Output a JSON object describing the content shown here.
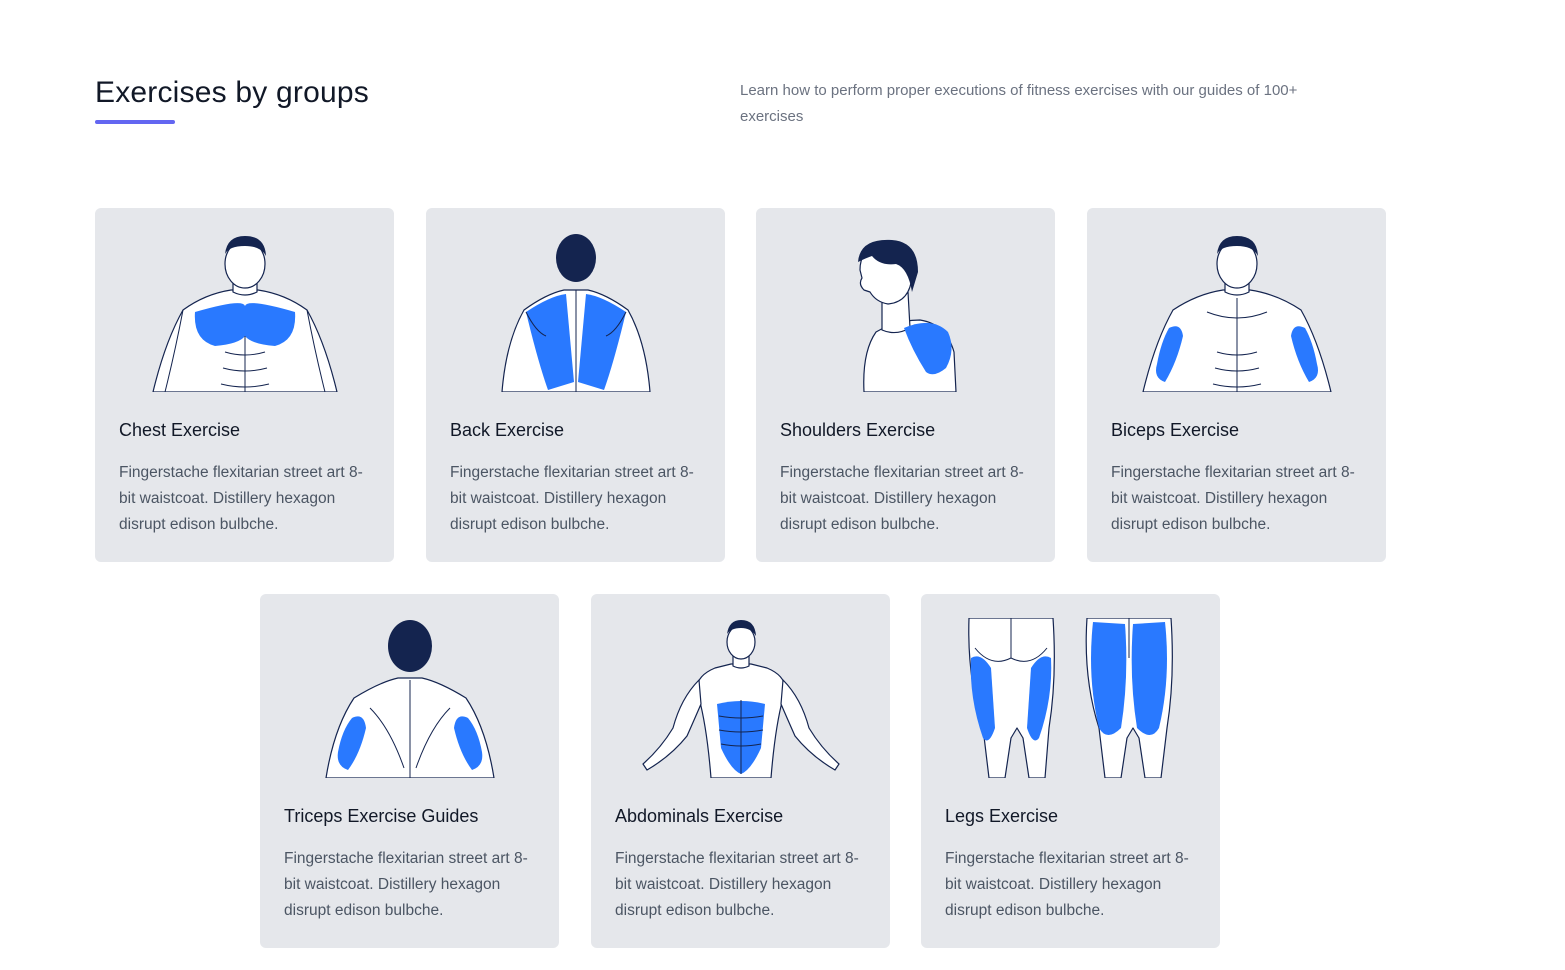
{
  "header": {
    "title": "Exercises by groups",
    "description": "Learn how to perform proper executions of fitness exercises with our guides of 100+ exercises"
  },
  "colors": {
    "accent": "#6366f1",
    "muscle_highlight": "#2979ff",
    "hair": "#14244f",
    "card_bg": "#e5e7eb"
  },
  "cards": [
    {
      "title": "Chest Exercise",
      "text": "Fingerstache flexitarian street art 8-bit waistcoat. Distillery hexagon disrupt edison bulbche.",
      "icon": "chest-muscle-icon"
    },
    {
      "title": "Back Exercise",
      "text": "Fingerstache flexitarian street art 8-bit waistcoat. Distillery hexagon disrupt edison bulbche.",
      "icon": "back-muscle-icon"
    },
    {
      "title": "Shoulders Exercise",
      "text": "Fingerstache flexitarian street art 8-bit waistcoat. Distillery hexagon disrupt edison bulbche.",
      "icon": "shoulder-muscle-icon"
    },
    {
      "title": "Biceps Exercise",
      "text": "Fingerstache flexitarian street art 8-bit waistcoat. Distillery hexagon disrupt edison bulbche.",
      "icon": "biceps-muscle-icon"
    },
    {
      "title": "Triceps Exercise Guides",
      "text": "Fingerstache flexitarian street art 8-bit waistcoat. Distillery hexagon disrupt edison bulbche.",
      "icon": "triceps-muscle-icon"
    },
    {
      "title": "Abdominals Exercise",
      "text": "Fingerstache flexitarian street art 8-bit waistcoat. Distillery hexagon disrupt edison bulbche.",
      "icon": "abdominals-muscle-icon"
    },
    {
      "title": "Legs Exercise",
      "text": "Fingerstache flexitarian street art 8-bit waistcoat. Distillery hexagon disrupt edison bulbche.",
      "icon": "legs-muscle-icon"
    }
  ]
}
